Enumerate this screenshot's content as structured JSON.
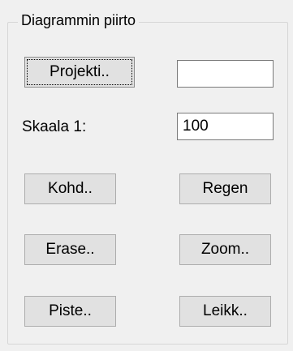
{
  "group": {
    "title": "Diagrammin piirto"
  },
  "fields": {
    "project_value": "",
    "scale_label": "Skaala 1:",
    "scale_value": "100"
  },
  "buttons": {
    "projekti": "Projekti..",
    "kohd": "Kohd..",
    "regen": "Regen",
    "erase": "Erase..",
    "zoom": "Zoom..",
    "piste": "Piste..",
    "leikk": "Leikk.."
  }
}
